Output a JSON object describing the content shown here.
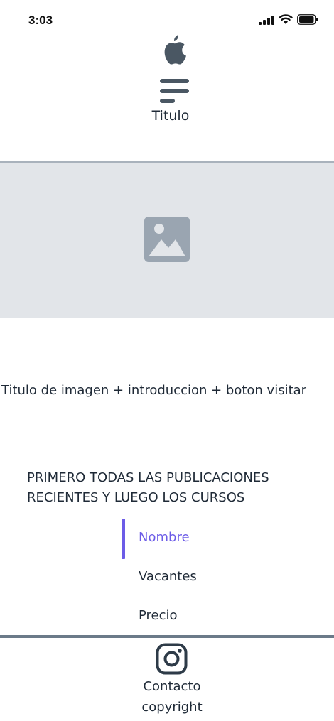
{
  "status_bar": {
    "time": "3:03",
    "icons": [
      "cellular-signal-icon",
      "wifi-icon",
      "battery-icon"
    ]
  },
  "header": {
    "logo": "apple-icon",
    "menu": "hamburger-menu-icon",
    "title": "Titulo"
  },
  "hero": {
    "icon": "image-placeholder-icon",
    "caption": "Titulo de imagen + introduccion + boton visitar"
  },
  "section": {
    "heading_line1": "PRIMERO TODAS LAS PUBLICACIONES",
    "heading_line2": "RECIENTES Y LUEGO LOS CURSOS"
  },
  "sort_options": [
    {
      "label": "Nombre",
      "active": true
    },
    {
      "label": "Vacantes",
      "active": false
    },
    {
      "label": "Precio",
      "active": false
    }
  ],
  "footer": {
    "social_icon": "instagram-icon",
    "contact": "Contacto",
    "copyright": "copyright"
  },
  "colors": {
    "accent": "#6c5ce7",
    "text": "#1f2a37",
    "placeholder_bg": "#e2e5e9",
    "icon_gray": "#9aa5b1",
    "divider": "#6b7a89"
  }
}
